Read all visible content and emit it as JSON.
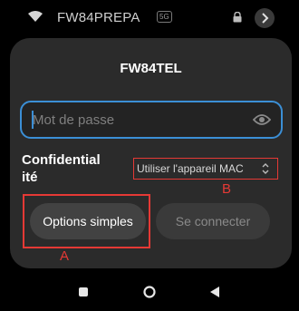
{
  "status_bar": {
    "ssid": "FW84PREPA",
    "band": "5G",
    "icons": [
      "wifi-icon",
      "lock-icon",
      "chevron-right-icon"
    ]
  },
  "dialog": {
    "title": "FW84TEL",
    "password": {
      "value": "",
      "placeholder": "Mot de passe"
    },
    "privacy": {
      "label": "Confidentialité",
      "label_line1": "Confidential",
      "label_line2": "ité",
      "selected": "Utiliser l'appareil MAC"
    },
    "buttons": {
      "simple": "Options simples",
      "connect": "Se connecter"
    }
  },
  "annotations": {
    "a": "A",
    "b": "B",
    "color": "#e53935"
  },
  "colors": {
    "accent": "#3b8fd6",
    "dialog_bg": "#2b2b2b",
    "annotation": "#e53935"
  },
  "nav_bar": {
    "icons": [
      "recents-square-icon",
      "home-circle-icon",
      "back-triangle-icon"
    ]
  }
}
